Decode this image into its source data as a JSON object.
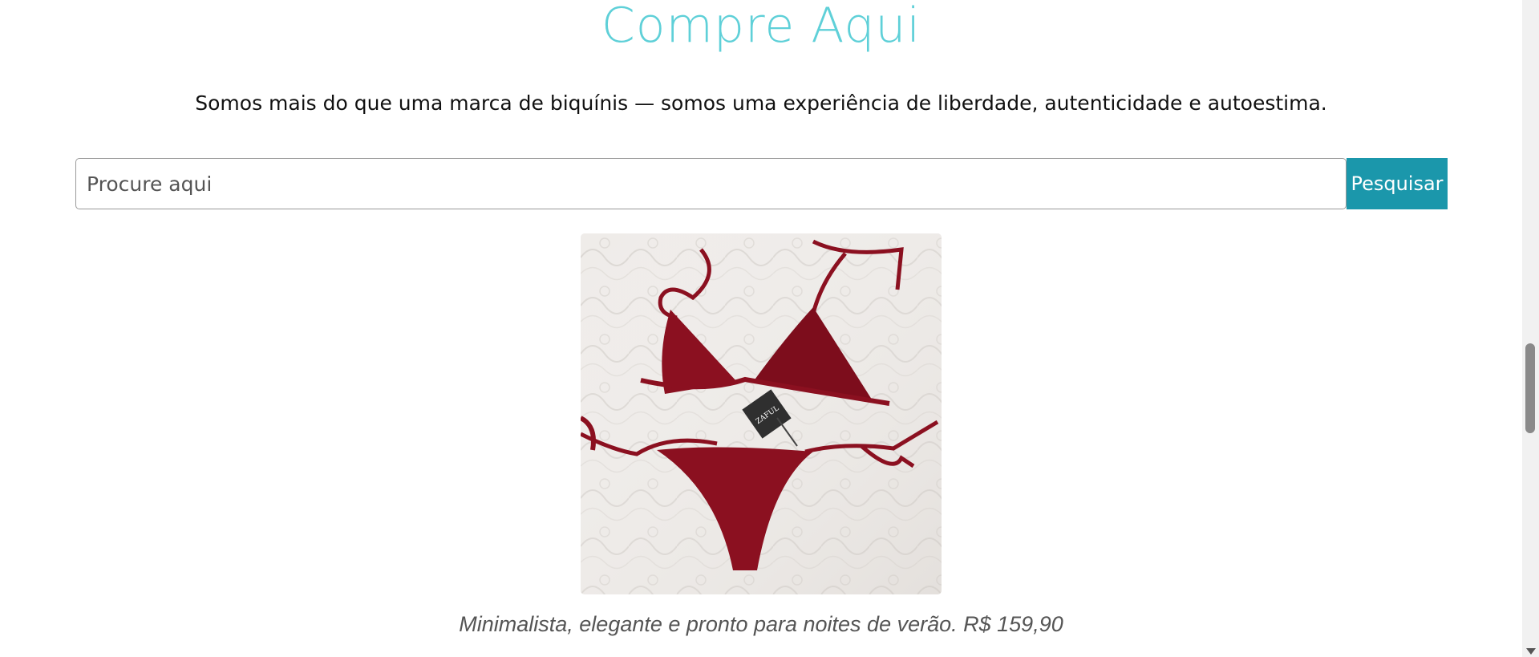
{
  "header": {
    "title": "Compre Aqui",
    "subtitle": "Somos mais do que uma marca de biquínis — somos uma experiência de liberdade, autenticidade e autoestima."
  },
  "search": {
    "placeholder": "Procure aqui",
    "value": "",
    "button_label": "Pesquisar"
  },
  "product": {
    "image_alt": "Red bikini set on white quilted fabric",
    "tag_text": "ZAFUL",
    "caption": "Minimalista, elegante e pronto para noites de verão. R$ 159,90"
  },
  "colors": {
    "title": "#5fd0d8",
    "button": "#1b97ab",
    "bikini": "#8b1020"
  }
}
